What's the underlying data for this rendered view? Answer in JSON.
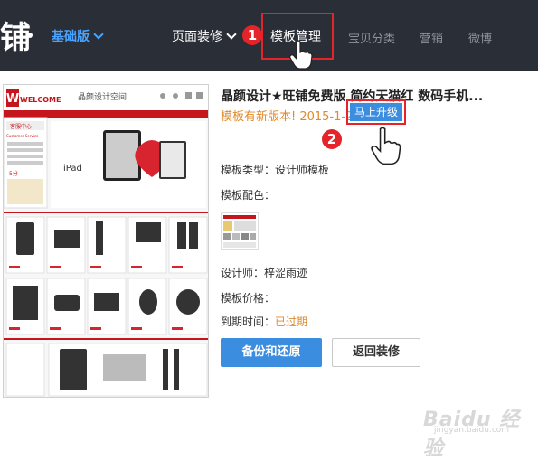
{
  "header": {
    "brand": "铺",
    "edition": "基础版",
    "nav": [
      "页面装修",
      "模板管理",
      "宝贝分类",
      "营销",
      "微博"
    ]
  },
  "annotations": {
    "step1": "1",
    "step2": "2"
  },
  "template": {
    "preview": {
      "logo": "WELCOME",
      "shop_name": "晶颜设计空间",
      "service": "客服中心",
      "service_sub": "Customer Service",
      "ipad": "iPad",
      "score": "5分"
    },
    "title": "晶颜设计★旺铺免费版 简约天猫红 数码手机...",
    "notice": "模板有新版本! 2015-1-24",
    "upgrade_label": "马上升级",
    "type_label": "模板类型：",
    "type_value": "设计师模板",
    "color_label": "模板配色：",
    "designer_label": "设计师：",
    "designer_value": "梓涩雨迹",
    "price_label": "模板价格：",
    "expire_label": "到期时间：",
    "expire_value": "已过期",
    "backup_button": "备份和还原",
    "return_button": "返回装修"
  },
  "watermark": {
    "text": "Baidu 经验",
    "sub": "jingyan.baidu.com"
  },
  "colors": {
    "topbar": "#2a2e36",
    "accent": "#3b8de0",
    "highlight": "#e5232a",
    "warning": "#e08a2c"
  }
}
